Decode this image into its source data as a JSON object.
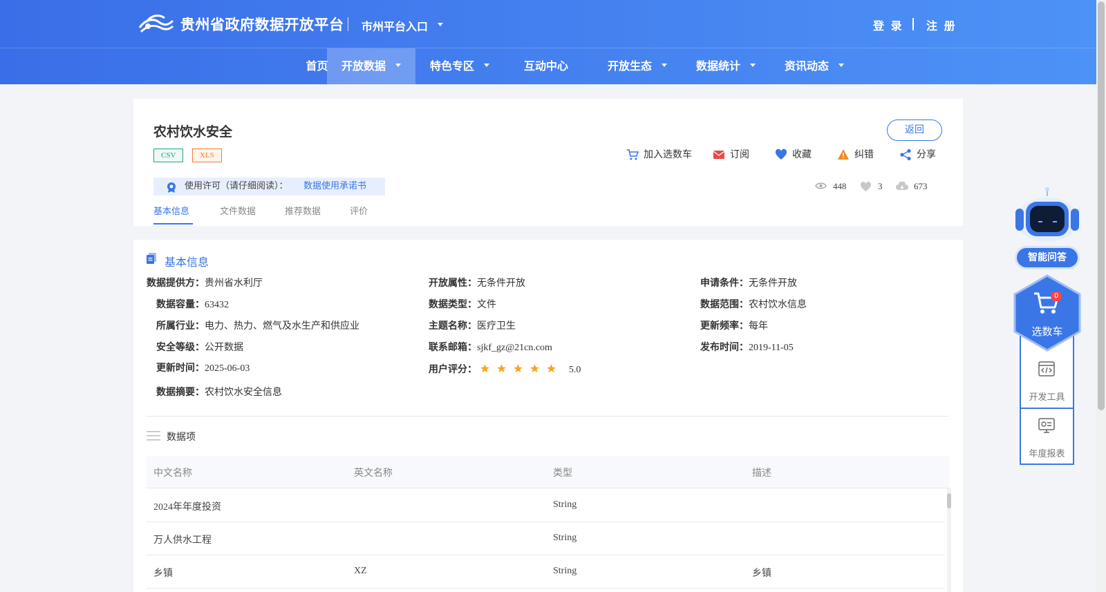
{
  "header": {
    "logo_text": "贵州省政府数据开放平台",
    "city_entry": "市州平台入口",
    "login": "登 录",
    "register": "注 册"
  },
  "nav": {
    "items": [
      {
        "label": "首页",
        "dropdown": false,
        "active": false
      },
      {
        "label": "开放数据",
        "dropdown": true,
        "active": true
      },
      {
        "label": "特色专区",
        "dropdown": true,
        "active": false
      },
      {
        "label": "互动中心",
        "dropdown": false,
        "active": false
      },
      {
        "label": "开放生态",
        "dropdown": true,
        "active": false
      },
      {
        "label": "数据统计",
        "dropdown": true,
        "active": false
      },
      {
        "label": "资讯动态",
        "dropdown": true,
        "active": false
      }
    ]
  },
  "dataset": {
    "title": "农村饮水安全",
    "tags": [
      "CSV",
      "XLS"
    ],
    "back_label": "返回",
    "actions": [
      {
        "label": "加入选数车",
        "icon": "cart-icon"
      },
      {
        "label": "订阅",
        "icon": "mail-icon"
      },
      {
        "label": "收藏",
        "icon": "heart-icon"
      },
      {
        "label": "纠错",
        "icon": "warning-icon"
      },
      {
        "label": "分享",
        "icon": "share-icon"
      }
    ],
    "license_text": "使用许可（请仔细阅读）：",
    "license_link": "数据使用承诺书",
    "stats": {
      "views": "448",
      "likes": "3",
      "downloads": "673"
    },
    "tabs": [
      "基本信息",
      "文件数据",
      "推荐数据",
      "评价"
    ],
    "active_tab": "基本信息"
  },
  "basic_info": {
    "section_title": "基本信息",
    "fields": {
      "provider": {
        "label": "数据提供方：",
        "value": "贵州省水利厅"
      },
      "open_attr": {
        "label": "开放属性：",
        "value": "无条件开放"
      },
      "apply_cond": {
        "label": "申请条件：",
        "value": "无条件开放"
      },
      "capacity": {
        "label": "数据容量：",
        "value": "63432"
      },
      "data_type": {
        "label": "数据类型：",
        "value": "文件"
      },
      "data_scope": {
        "label": "数据范围：",
        "value": "农村饮水信息"
      },
      "industry": {
        "label": "所属行业：",
        "value": "电力、热力、燃气及水生产和供应业"
      },
      "topic": {
        "label": "主题名称：",
        "value": "医疗卫生"
      },
      "frequency": {
        "label": "更新频率：",
        "value": "每年"
      },
      "security": {
        "label": "安全等级：",
        "value": "公开数据"
      },
      "email": {
        "label": "联系邮箱：",
        "value": "sjkf_gz@21cn.com"
      },
      "publish_time": {
        "label": "发布时间：",
        "value": "2019-11-05"
      },
      "update_time": {
        "label": "更新时间：",
        "value": "2025-06-03"
      },
      "rating": {
        "label": "用户评分：",
        "value": "5.0",
        "stars": 5
      },
      "summary": {
        "label": "数据摘要：",
        "value": "农村饮水安全信息"
      }
    }
  },
  "data_items": {
    "title": "数据项",
    "columns": [
      "中文名称",
      "英文名称",
      "类型",
      "描述"
    ],
    "rows": [
      [
        "2024年年度投资",
        "",
        "String",
        ""
      ],
      [
        "万人供水工程",
        "",
        "String",
        ""
      ],
      [
        "乡镇",
        "XZ",
        "String",
        "乡镇"
      ]
    ]
  },
  "sidebar": {
    "ask_label": "智能问答",
    "cart_label": "选数车",
    "cart_count": "0",
    "dev_tools": "开发工具",
    "annual_report": "年度报表"
  },
  "colors": {
    "primary": "#3a76e6",
    "csv": "#1fa589",
    "xls": "#f07b35",
    "star": "#f5a623"
  }
}
